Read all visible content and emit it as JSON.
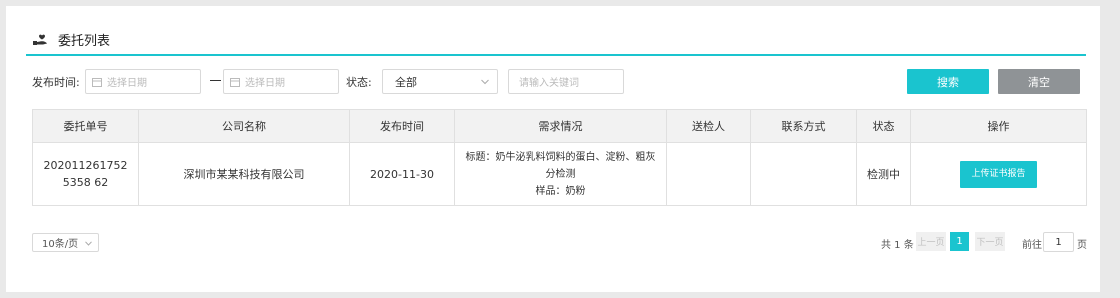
{
  "section": {
    "title": "委托列表",
    "icon": "hand-holding-icon"
  },
  "filters": {
    "publish_time_label": "发布时间:",
    "start_date_placeholder": "选择日期",
    "end_date_placeholder": "选择日期",
    "status_label": "状态:",
    "status_value": "全部",
    "keyword_placeholder": "请输入关键词",
    "search_label": "搜索",
    "clear_label": "清空"
  },
  "table": {
    "columns": [
      "委托单号",
      "公司名称",
      "发布时间",
      "需求情况",
      "送检人",
      "联系方式",
      "状态",
      "操作"
    ],
    "rows": [
      {
        "order_no": "2020112617525358 62",
        "company": "深圳市某某科技有限公司",
        "publish_time": "2020-11-30",
        "requirement_title": "标题：奶牛泌乳料饲料的蛋白、淀粉、粗灰分检测",
        "requirement_sample": "样品：奶粉",
        "inspector": "",
        "contact": "",
        "status": "检测中",
        "action_label": "上传证书报告"
      }
    ]
  },
  "pagination": {
    "page_size": "10条/页",
    "total": "共 1 条",
    "prev_label": "上一页",
    "current_page": "1",
    "next_label": "下一页",
    "goto_label": "前往",
    "goto_value": "1",
    "goto_suffix": "页"
  },
  "colors": {
    "accent": "#1ac4cf",
    "clear_button": "#8f9396",
    "background": "#e9e9e9"
  }
}
